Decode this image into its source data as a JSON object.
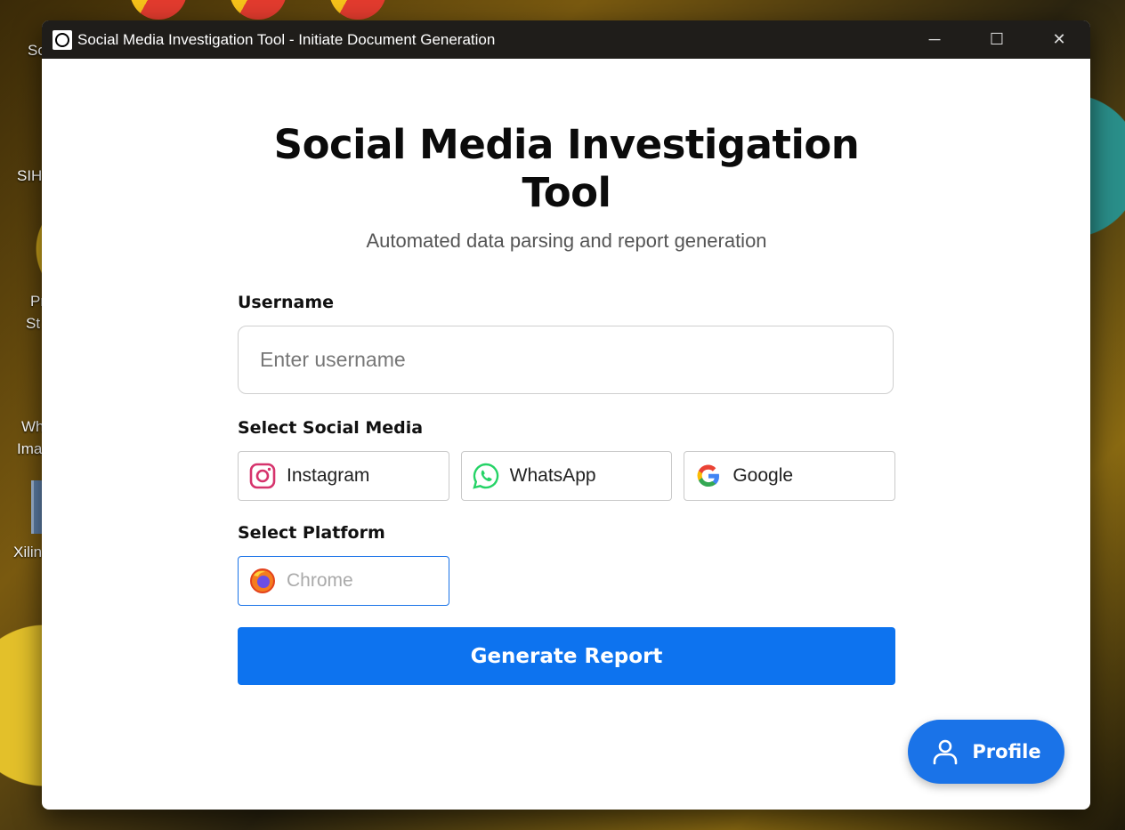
{
  "window": {
    "title": "Social Media Investigation Tool - Initiate Document Generation",
    "minimize_glyph": "─",
    "maximize_glyph": "☐",
    "close_glyph": "✕"
  },
  "desktop": {
    "labels": [
      "So",
      "SIH",
      "Pr",
      "St",
      "Wh",
      "Ima",
      "Xilin"
    ]
  },
  "header": {
    "title": "Social Media Investigation Tool",
    "subtitle": "Automated data parsing and report generation"
  },
  "form": {
    "username_label": "Username",
    "username_placeholder": "Enter username",
    "username_value": "",
    "social_label": "Select Social Media",
    "social_options": [
      {
        "label": "Instagram",
        "icon": "instagram-icon"
      },
      {
        "label": "WhatsApp",
        "icon": "whatsapp-icon"
      },
      {
        "label": "Google",
        "icon": "google-icon"
      }
    ],
    "platform_label": "Select Platform",
    "platform_value": "Chrome",
    "generate_label": "Generate Report"
  },
  "profile": {
    "label": "Profile"
  },
  "colors": {
    "accent": "#0d73ef",
    "titlebar": "#1f1d1a"
  }
}
